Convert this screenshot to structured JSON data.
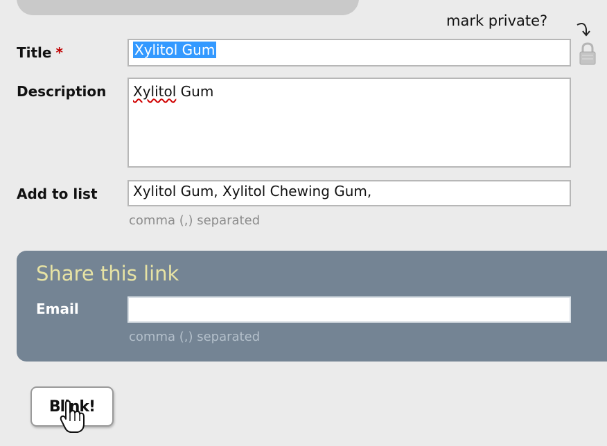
{
  "header": {
    "mark_private": "mark private?"
  },
  "form": {
    "title_label": "Title",
    "required_mark": "*",
    "title_value": "Xylitol Gum",
    "description_label": "Description",
    "description_value_word1": "Xylitol",
    "description_value_word2": " Gum",
    "list_label": "Add to list",
    "list_value": "Xylitol Gum, Xylitol Chewing Gum,",
    "list_hint": "comma (,) separated"
  },
  "share": {
    "heading": "Share this link",
    "email_label": "Email",
    "email_value": "",
    "email_hint": "comma (,) separated"
  },
  "actions": {
    "submit_label": "Blink!"
  },
  "icons": {
    "mark_private_arrow": "curved-arrow-down-icon",
    "lock": "lock-icon",
    "cursor": "hand-pointer-cursor-icon"
  },
  "colors": {
    "background": "#ebebeb",
    "share_panel": "#748494",
    "share_heading": "#e7e3a4",
    "required": "#c00000",
    "selection": "#3399ff"
  }
}
